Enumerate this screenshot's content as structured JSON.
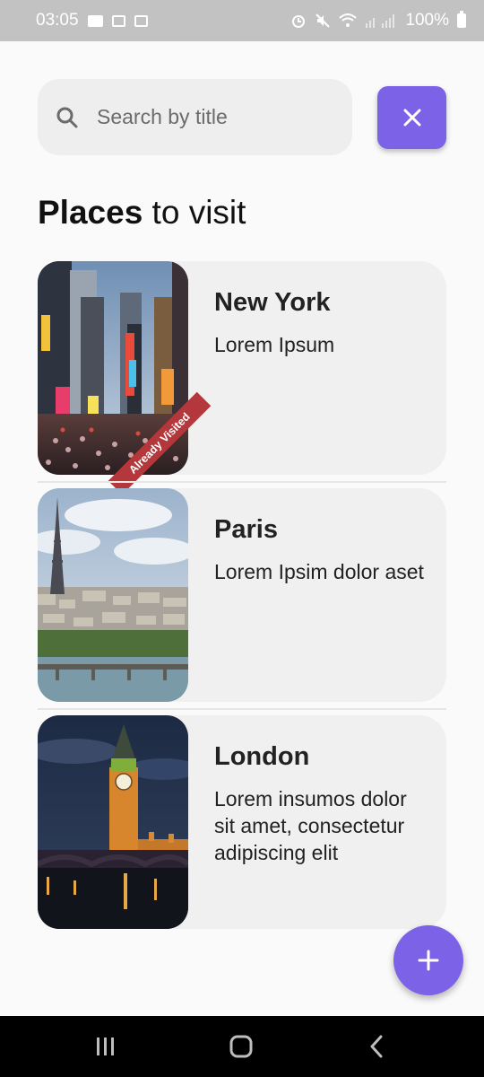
{
  "status_bar": {
    "time": "03:05",
    "battery": "100%"
  },
  "search": {
    "placeholder": "Search by title",
    "value": ""
  },
  "header": {
    "title_bold": "Places",
    "title_rest": " to visit"
  },
  "places": [
    {
      "title": "New York",
      "description": "Lorem Ipsum",
      "badge": "Already Visited",
      "image": "times-square-photo"
    },
    {
      "title": "Paris",
      "description": "Lorem Ipsim dolor aset",
      "badge": "",
      "image": "eiffel-tower-photo"
    },
    {
      "title": "London",
      "description": "Lorem insumos dolor sit amet, consectetur adipiscing elit",
      "badge": "",
      "image": "big-ben-photo"
    }
  ],
  "colors": {
    "accent": "#7c62e6",
    "badge": "#b4383b",
    "card_bg": "#f0f0f0",
    "search_bg": "#eeeeee"
  },
  "icons": {
    "clear": "close-icon",
    "search": "search-icon",
    "fab": "plus-icon",
    "nav_recents": "recents-icon",
    "nav_home": "home-icon",
    "nav_back": "back-icon"
  }
}
